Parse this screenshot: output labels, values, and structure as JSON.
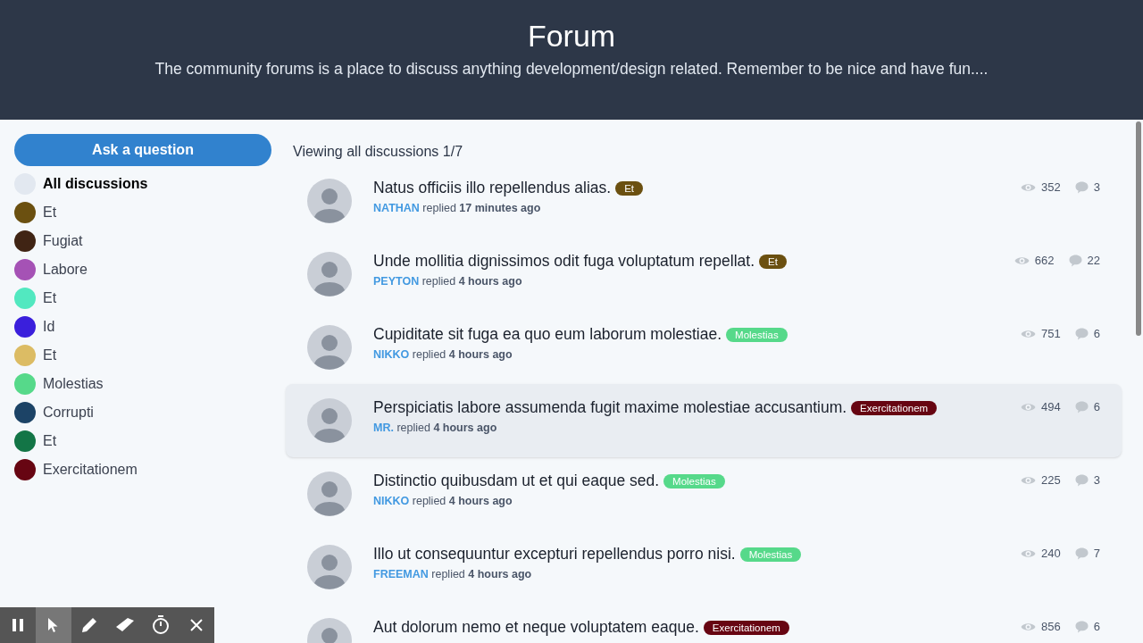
{
  "header": {
    "title": "Forum",
    "subtitle": "The community forums is a place to discuss anything development/design related. Remember to be nice and have fun...."
  },
  "sidebar": {
    "button": "Ask a question",
    "items": [
      {
        "label": "All discussions",
        "color": "#e2e8f0",
        "selected": true
      },
      {
        "label": "Et",
        "color": "#6b5010",
        "selected": false
      },
      {
        "label": "Fugiat",
        "color": "#402414",
        "selected": false
      },
      {
        "label": "Labore",
        "color": "#a552b5",
        "selected": false
      },
      {
        "label": "Et",
        "color": "#52e8c0",
        "selected": false
      },
      {
        "label": "Id",
        "color": "#3a1fdc",
        "selected": false
      },
      {
        "label": "Et",
        "color": "#dcbc64",
        "selected": false
      },
      {
        "label": "Molestias",
        "color": "#56d98a",
        "selected": false
      },
      {
        "label": "Corrupti",
        "color": "#1c4366",
        "selected": false
      },
      {
        "label": "Et",
        "color": "#137546",
        "selected": false
      },
      {
        "label": "Exercitationem",
        "color": "#670512",
        "selected": false
      }
    ]
  },
  "heading": "Viewing all discussions 1/7",
  "discussions": [
    {
      "title": "Natus officiis illo repellendus alias.",
      "tag": "Et",
      "color": "#6b5010",
      "user": "NATHAN",
      "action": "replied",
      "time": "17 minutes ago",
      "views": "352",
      "replies": "3",
      "highlighted": false
    },
    {
      "title": "Unde mollitia dignissimos odit fuga voluptatum repellat.",
      "tag": "Et",
      "color": "#6b5010",
      "user": "PEYTON",
      "action": "replied",
      "time": "4 hours ago",
      "views": "662",
      "replies": "22",
      "highlighted": false
    },
    {
      "title": "Cupiditate sit fuga ea quo eum laborum molestiae.",
      "tag": "Molestias",
      "color": "#56d98a",
      "user": "NIKKO",
      "action": "replied",
      "time": "4 hours ago",
      "views": "751",
      "replies": "6",
      "highlighted": false
    },
    {
      "title": "Perspiciatis labore assumenda fugit maxime molestiae accusantium.",
      "tag": "Exercitationem",
      "color": "#670512",
      "user": "MR.",
      "action": "replied",
      "time": "4 hours ago",
      "views": "494",
      "replies": "6",
      "highlighted": true
    },
    {
      "title": "Distinctio quibusdam ut et qui eaque sed.",
      "tag": "Molestias",
      "color": "#56d98a",
      "user": "NIKKO",
      "action": "replied",
      "time": "4 hours ago",
      "views": "225",
      "replies": "3",
      "highlighted": false
    },
    {
      "title": "Illo ut consequuntur excepturi repellendus porro nisi.",
      "tag": "Molestias",
      "color": "#56d98a",
      "user": "FREEMAN",
      "action": "replied",
      "time": "4 hours ago",
      "views": "240",
      "replies": "7",
      "highlighted": false
    },
    {
      "title": "Aut dolorum nemo et neque voluptatem eaque.",
      "tag": "Exercitationem",
      "color": "#670512",
      "views": "856",
      "replies": "6",
      "highlighted": false
    }
  ],
  "recorder_toolbar": [
    {
      "kind": "pause",
      "selected": false
    },
    {
      "kind": "cursor",
      "selected": true
    },
    {
      "kind": "pen",
      "selected": false
    },
    {
      "kind": "eraser",
      "selected": false
    },
    {
      "kind": "timer",
      "selected": false
    },
    {
      "kind": "close",
      "selected": false
    }
  ]
}
